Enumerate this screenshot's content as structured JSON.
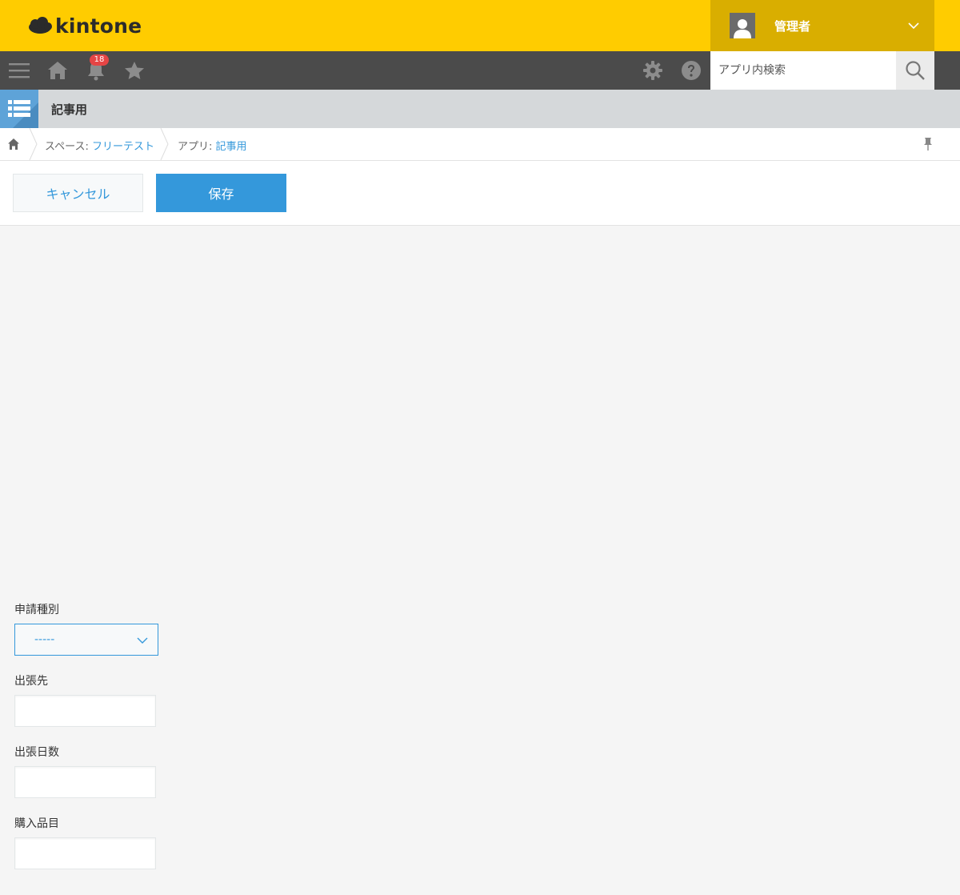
{
  "header": {
    "logo_text": "kintone",
    "user_name": "管理者",
    "brand_color": "#ffcc00"
  },
  "toolbar": {
    "notification_count": "18",
    "search_placeholder": "アプリ内検索",
    "icons": [
      "menu-icon",
      "home-icon",
      "bell-icon",
      "star-icon",
      "gear-icon",
      "help-icon",
      "search-icon"
    ]
  },
  "app": {
    "title": "記事用"
  },
  "breadcrumb": {
    "space_label": "スペース: ",
    "space_name": "フリーテスト",
    "app_label": "アプリ: ",
    "app_name": "記事用"
  },
  "actions": {
    "cancel_label": "キャンセル",
    "save_label": "保存",
    "accent_color": "#3498db"
  },
  "form": {
    "fields": [
      {
        "label": "申請種別",
        "type": "dropdown",
        "value": "-----"
      },
      {
        "label": "出張先",
        "type": "text",
        "value": ""
      },
      {
        "label": "出張日数",
        "type": "text",
        "value": ""
      },
      {
        "label": "購入品目",
        "type": "text",
        "value": ""
      }
    ]
  }
}
